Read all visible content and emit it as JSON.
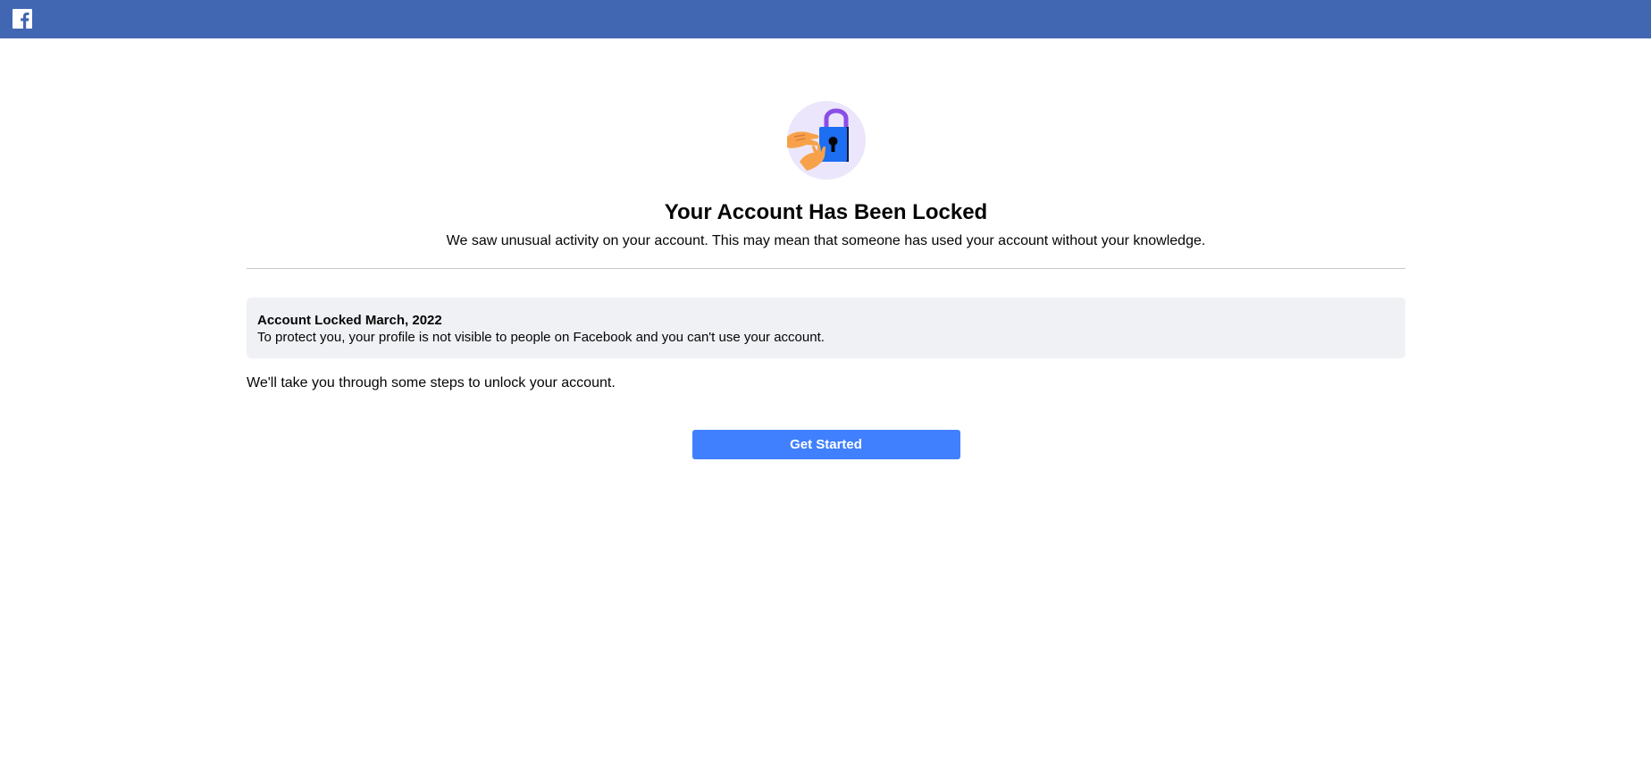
{
  "header": {
    "logo_icon": "facebook-logo-icon",
    "brand_color": "#4267b2"
  },
  "hero": {
    "icon": "padlock-hands-illustration"
  },
  "main": {
    "title": "Your Account Has Been Locked",
    "subtitle": "We saw unusual activity on your account. This may mean that someone has used your account without your knowledge."
  },
  "notice": {
    "title": "Account Locked March, 2022",
    "body": "To protect you, your profile is not visible to people on Facebook and you can't use your account."
  },
  "steps_text": "We'll take you through some steps to unlock your account.",
  "actions": {
    "get_started_label": "Get Started",
    "button_color": "#4080ff"
  }
}
